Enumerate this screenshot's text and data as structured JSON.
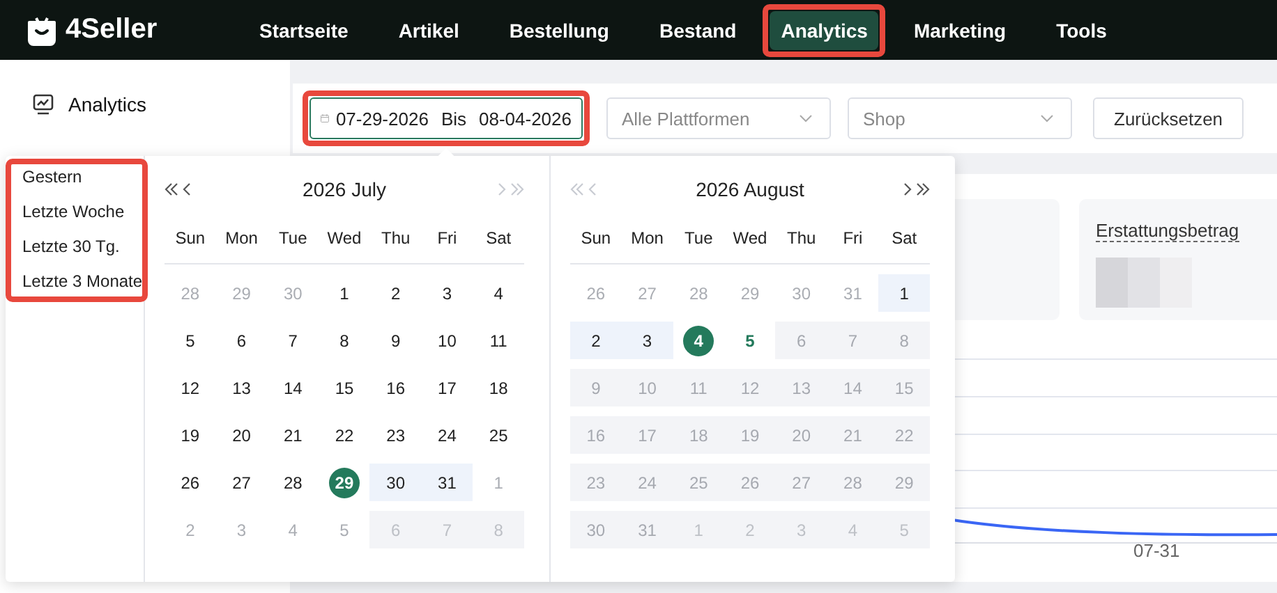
{
  "brand": "4Seller",
  "nav": [
    {
      "label": "Startseite",
      "selected": false,
      "highlight": false
    },
    {
      "label": "Artikel",
      "selected": false,
      "highlight": false
    },
    {
      "label": "Bestellung",
      "selected": false,
      "highlight": false
    },
    {
      "label": "Bestand",
      "selected": false,
      "highlight": false
    },
    {
      "label": "Analytics",
      "selected": true,
      "highlight": true
    },
    {
      "label": "Marketing",
      "selected": false,
      "highlight": false
    },
    {
      "label": "Tools",
      "selected": false,
      "highlight": false
    }
  ],
  "sidebar": {
    "items": [
      {
        "label": "Analytics",
        "selected": true
      }
    ]
  },
  "filters": {
    "date_range": {
      "start": "07-29-2026",
      "separator": "Bis",
      "end": "08-04-2026",
      "focused": true,
      "highlight": true
    },
    "platform": {
      "placeholder": "Alle Plattformen"
    },
    "shop": {
      "placeholder": "Shop"
    },
    "reset_button": "Zurücksetzen"
  },
  "cards": [
    {
      "title": "Erstattungsbetrag",
      "value_blurred": true
    }
  ],
  "chart": {
    "x_labels": [
      "07-31"
    ]
  },
  "date_picker": {
    "presets": {
      "highlight": true,
      "items": [
        "Gestern",
        "Letzte Woche",
        "Letzte 30 Tg.",
        "Letzte 3 Monate"
      ]
    },
    "months": [
      {
        "title": "2026 July",
        "prev_enabled": true,
        "next_enabled": false,
        "weekdays": [
          "Sun",
          "Mon",
          "Tue",
          "Wed",
          "Thu",
          "Fri",
          "Sat"
        ],
        "weeks": [
          [
            {
              "day": "28",
              "other_month": true,
              "disabled": false,
              "in_range": false,
              "selected": false,
              "today": false
            },
            {
              "day": "29",
              "other_month": true,
              "disabled": false,
              "in_range": false,
              "selected": false,
              "today": false
            },
            {
              "day": "30",
              "other_month": true,
              "disabled": false,
              "in_range": false,
              "selected": false,
              "today": false
            },
            {
              "day": "1",
              "other_month": false,
              "disabled": false,
              "in_range": false,
              "selected": false,
              "today": false
            },
            {
              "day": "2",
              "other_month": false,
              "disabled": false,
              "in_range": false,
              "selected": false,
              "today": false
            },
            {
              "day": "3",
              "other_month": false,
              "disabled": false,
              "in_range": false,
              "selected": false,
              "today": false
            },
            {
              "day": "4",
              "other_month": false,
              "disabled": false,
              "in_range": false,
              "selected": false,
              "today": false
            }
          ],
          [
            {
              "day": "5",
              "other_month": false,
              "disabled": false,
              "in_range": false,
              "selected": false,
              "today": false
            },
            {
              "day": "6",
              "other_month": false,
              "disabled": false,
              "in_range": false,
              "selected": false,
              "today": false
            },
            {
              "day": "7",
              "other_month": false,
              "disabled": false,
              "in_range": false,
              "selected": false,
              "today": false
            },
            {
              "day": "8",
              "other_month": false,
              "disabled": false,
              "in_range": false,
              "selected": false,
              "today": false
            },
            {
              "day": "9",
              "other_month": false,
              "disabled": false,
              "in_range": false,
              "selected": false,
              "today": false
            },
            {
              "day": "10",
              "other_month": false,
              "disabled": false,
              "in_range": false,
              "selected": false,
              "today": false
            },
            {
              "day": "11",
              "other_month": false,
              "disabled": false,
              "in_range": false,
              "selected": false,
              "today": false
            }
          ],
          [
            {
              "day": "12",
              "other_month": false,
              "disabled": false,
              "in_range": false,
              "selected": false,
              "today": false
            },
            {
              "day": "13",
              "other_month": false,
              "disabled": false,
              "in_range": false,
              "selected": false,
              "today": false
            },
            {
              "day": "14",
              "other_month": false,
              "disabled": false,
              "in_range": false,
              "selected": false,
              "today": false
            },
            {
              "day": "15",
              "other_month": false,
              "disabled": false,
              "in_range": false,
              "selected": false,
              "today": false
            },
            {
              "day": "16",
              "other_month": false,
              "disabled": false,
              "in_range": false,
              "selected": false,
              "today": false
            },
            {
              "day": "17",
              "other_month": false,
              "disabled": false,
              "in_range": false,
              "selected": false,
              "today": false
            },
            {
              "day": "18",
              "other_month": false,
              "disabled": false,
              "in_range": false,
              "selected": false,
              "today": false
            }
          ],
          [
            {
              "day": "19",
              "other_month": false,
              "disabled": false,
              "in_range": false,
              "selected": false,
              "today": false
            },
            {
              "day": "20",
              "other_month": false,
              "disabled": false,
              "in_range": false,
              "selected": false,
              "today": false
            },
            {
              "day": "21",
              "other_month": false,
              "disabled": false,
              "in_range": false,
              "selected": false,
              "today": false
            },
            {
              "day": "22",
              "other_month": false,
              "disabled": false,
              "in_range": false,
              "selected": false,
              "today": false
            },
            {
              "day": "23",
              "other_month": false,
              "disabled": false,
              "in_range": false,
              "selected": false,
              "today": false
            },
            {
              "day": "24",
              "other_month": false,
              "disabled": false,
              "in_range": false,
              "selected": false,
              "today": false
            },
            {
              "day": "25",
              "other_month": false,
              "disabled": false,
              "in_range": false,
              "selected": false,
              "today": false
            }
          ],
          [
            {
              "day": "26",
              "other_month": false,
              "disabled": false,
              "in_range": false,
              "selected": false,
              "today": false
            },
            {
              "day": "27",
              "other_month": false,
              "disabled": false,
              "in_range": false,
              "selected": false,
              "today": false
            },
            {
              "day": "28",
              "other_month": false,
              "disabled": false,
              "in_range": false,
              "selected": false,
              "today": false
            },
            {
              "day": "29",
              "other_month": false,
              "disabled": false,
              "in_range": false,
              "selected": true,
              "today": false
            },
            {
              "day": "30",
              "other_month": false,
              "disabled": false,
              "in_range": true,
              "selected": false,
              "today": false
            },
            {
              "day": "31",
              "other_month": false,
              "disabled": false,
              "in_range": true,
              "selected": false,
              "today": false
            },
            {
              "day": "1",
              "other_month": true,
              "disabled": false,
              "in_range": false,
              "selected": false,
              "today": false
            }
          ],
          [
            {
              "day": "2",
              "other_month": true,
              "disabled": false,
              "in_range": false,
              "selected": false,
              "today": false
            },
            {
              "day": "3",
              "other_month": true,
              "disabled": false,
              "in_range": false,
              "selected": false,
              "today": false
            },
            {
              "day": "4",
              "other_month": true,
              "disabled": false,
              "in_range": false,
              "selected": false,
              "today": false
            },
            {
              "day": "5",
              "other_month": true,
              "disabled": false,
              "in_range": false,
              "selected": false,
              "today": false
            },
            {
              "day": "6",
              "other_month": true,
              "disabled": true,
              "in_range": false,
              "selected": false,
              "today": false
            },
            {
              "day": "7",
              "other_month": true,
              "disabled": true,
              "in_range": false,
              "selected": false,
              "today": false
            },
            {
              "day": "8",
              "other_month": true,
              "disabled": true,
              "in_range": false,
              "selected": false,
              "today": false
            }
          ]
        ]
      },
      {
        "title": "2026 August",
        "prev_enabled": false,
        "next_enabled": true,
        "weekdays": [
          "Sun",
          "Mon",
          "Tue",
          "Wed",
          "Thu",
          "Fri",
          "Sat"
        ],
        "weeks": [
          [
            {
              "day": "26",
              "other_month": true,
              "disabled": false,
              "in_range": false,
              "selected": false,
              "today": false
            },
            {
              "day": "27",
              "other_month": true,
              "disabled": false,
              "in_range": false,
              "selected": false,
              "today": false
            },
            {
              "day": "28",
              "other_month": true,
              "disabled": false,
              "in_range": false,
              "selected": false,
              "today": false
            },
            {
              "day": "29",
              "other_month": true,
              "disabled": false,
              "in_range": false,
              "selected": false,
              "today": false
            },
            {
              "day": "30",
              "other_month": true,
              "disabled": false,
              "in_range": false,
              "selected": false,
              "today": false
            },
            {
              "day": "31",
              "other_month": true,
              "disabled": false,
              "in_range": false,
              "selected": false,
              "today": false
            },
            {
              "day": "1",
              "other_month": false,
              "disabled": false,
              "in_range": true,
              "selected": false,
              "today": false
            }
          ],
          [
            {
              "day": "2",
              "other_month": false,
              "disabled": false,
              "in_range": true,
              "selected": false,
              "today": false
            },
            {
              "day": "3",
              "other_month": false,
              "disabled": false,
              "in_range": true,
              "selected": false,
              "today": false
            },
            {
              "day": "4",
              "other_month": false,
              "disabled": false,
              "in_range": false,
              "selected": true,
              "today": false
            },
            {
              "day": "5",
              "other_month": false,
              "disabled": false,
              "in_range": false,
              "selected": false,
              "today": true
            },
            {
              "day": "6",
              "other_month": false,
              "disabled": true,
              "in_range": false,
              "selected": false,
              "today": false
            },
            {
              "day": "7",
              "other_month": false,
              "disabled": true,
              "in_range": false,
              "selected": false,
              "today": false
            },
            {
              "day": "8",
              "other_month": false,
              "disabled": true,
              "in_range": false,
              "selected": false,
              "today": false
            }
          ],
          [
            {
              "day": "9",
              "other_month": false,
              "disabled": true,
              "in_range": false,
              "selected": false,
              "today": false
            },
            {
              "day": "10",
              "other_month": false,
              "disabled": true,
              "in_range": false,
              "selected": false,
              "today": false
            },
            {
              "day": "11",
              "other_month": false,
              "disabled": true,
              "in_range": false,
              "selected": false,
              "today": false
            },
            {
              "day": "12",
              "other_month": false,
              "disabled": true,
              "in_range": false,
              "selected": false,
              "today": false
            },
            {
              "day": "13",
              "other_month": false,
              "disabled": true,
              "in_range": false,
              "selected": false,
              "today": false
            },
            {
              "day": "14",
              "other_month": false,
              "disabled": true,
              "in_range": false,
              "selected": false,
              "today": false
            },
            {
              "day": "15",
              "other_month": false,
              "disabled": true,
              "in_range": false,
              "selected": false,
              "today": false
            }
          ],
          [
            {
              "day": "16",
              "other_month": false,
              "disabled": true,
              "in_range": false,
              "selected": false,
              "today": false
            },
            {
              "day": "17",
              "other_month": false,
              "disabled": true,
              "in_range": false,
              "selected": false,
              "today": false
            },
            {
              "day": "18",
              "other_month": false,
              "disabled": true,
              "in_range": false,
              "selected": false,
              "today": false
            },
            {
              "day": "19",
              "other_month": false,
              "disabled": true,
              "in_range": false,
              "selected": false,
              "today": false
            },
            {
              "day": "20",
              "other_month": false,
              "disabled": true,
              "in_range": false,
              "selected": false,
              "today": false
            },
            {
              "day": "21",
              "other_month": false,
              "disabled": true,
              "in_range": false,
              "selected": false,
              "today": false
            },
            {
              "day": "22",
              "other_month": false,
              "disabled": true,
              "in_range": false,
              "selected": false,
              "today": false
            }
          ],
          [
            {
              "day": "23",
              "other_month": false,
              "disabled": true,
              "in_range": false,
              "selected": false,
              "today": false
            },
            {
              "day": "24",
              "other_month": false,
              "disabled": true,
              "in_range": false,
              "selected": false,
              "today": false
            },
            {
              "day": "25",
              "other_month": false,
              "disabled": true,
              "in_range": false,
              "selected": false,
              "today": false
            },
            {
              "day": "26",
              "other_month": false,
              "disabled": true,
              "in_range": false,
              "selected": false,
              "today": false
            },
            {
              "day": "27",
              "other_month": false,
              "disabled": true,
              "in_range": false,
              "selected": false,
              "today": false
            },
            {
              "day": "28",
              "other_month": false,
              "disabled": true,
              "in_range": false,
              "selected": false,
              "today": false
            },
            {
              "day": "29",
              "other_month": false,
              "disabled": true,
              "in_range": false,
              "selected": false,
              "today": false
            }
          ],
          [
            {
              "day": "30",
              "other_month": false,
              "disabled": true,
              "in_range": false,
              "selected": false,
              "today": false
            },
            {
              "day": "31",
              "other_month": false,
              "disabled": true,
              "in_range": false,
              "selected": false,
              "today": false
            },
            {
              "day": "1",
              "other_month": true,
              "disabled": true,
              "in_range": false,
              "selected": false,
              "today": false
            },
            {
              "day": "2",
              "other_month": true,
              "disabled": true,
              "in_range": false,
              "selected": false,
              "today": false
            },
            {
              "day": "3",
              "other_month": true,
              "disabled": true,
              "in_range": false,
              "selected": false,
              "today": false
            },
            {
              "day": "4",
              "other_month": true,
              "disabled": true,
              "in_range": false,
              "selected": false,
              "today": false
            },
            {
              "day": "5",
              "other_month": true,
              "disabled": true,
              "in_range": false,
              "selected": false,
              "today": false
            }
          ]
        ]
      }
    ]
  }
}
